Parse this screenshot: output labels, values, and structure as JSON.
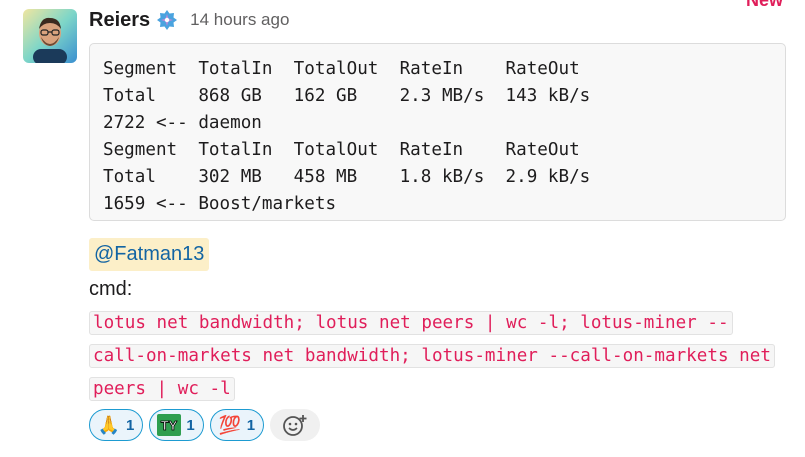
{
  "new_label": "New",
  "message": {
    "sender": "Reiers",
    "timestamp": "14 hours ago",
    "code_block": {
      "lines": [
        "Segment  TotalIn  TotalOut  RateIn    RateOut",
        "Total    868 GB   162 GB    2.3 MB/s  143 kB/s",
        "2722 <-- daemon",
        "Segment  TotalIn  TotalOut  RateIn    RateOut",
        "Total    302 MB   458 MB    1.8 kB/s  2.9 kB/s",
        "1659 <-- Boost/markets"
      ]
    },
    "mention": "@Fatman13",
    "cmd_label": "cmd:",
    "inline_code_lines": [
      "lotus net bandwidth; lotus net peers | wc -l; lotus-miner --",
      "call-on-markets net bandwidth; lotus-miner --call-on-markets net",
      "peers | wc -l"
    ]
  },
  "reactions": [
    {
      "icon": "folded-hands-icon",
      "emoji": "🙏",
      "count": "1"
    },
    {
      "icon": "ty-icon",
      "emoji": "TY",
      "count": "1"
    },
    {
      "icon": "hundred-points-icon",
      "emoji": "💯",
      "count": "1"
    }
  ],
  "colors": {
    "mention_bg": "#fcefc8",
    "mention_text": "#1264a3",
    "inline_code": "#e01e5a",
    "reaction_border": "#1d9bd1"
  }
}
